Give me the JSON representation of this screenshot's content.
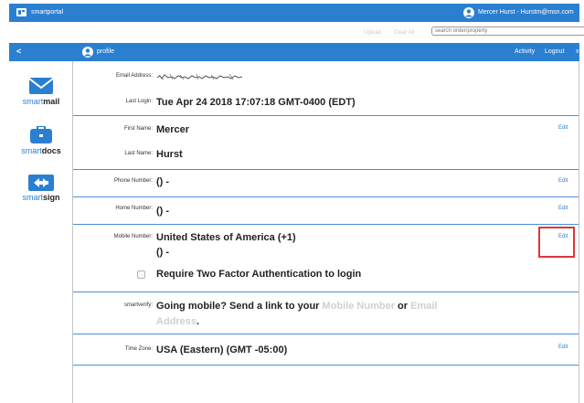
{
  "topbar": {
    "brand": "smartportal",
    "user": "Mercer Hurst - Hurstm@msn.com"
  },
  "subbar": {
    "upload": "Upload",
    "clear_all": "Clear All",
    "search_placeholder": "search order/property"
  },
  "navbar": {
    "back": "<",
    "profile": "profile",
    "activity": "Activity",
    "logout": "Logout",
    "close": "x"
  },
  "sidebar": {
    "items": [
      {
        "prefix": "smart",
        "bold": "mail",
        "icon": "envelope-icon"
      },
      {
        "prefix": "smart",
        "bold": "docs",
        "icon": "briefcase-icon"
      },
      {
        "prefix": "smart",
        "bold": "sign",
        "icon": "sign-arrows-icon"
      }
    ]
  },
  "profile": {
    "email_label": "Email Address:",
    "last_login_label": "Last Login:",
    "last_login": "Tue Apr 24 2018 17:07:18 GMT-0400 (EDT)",
    "first_name_label": "First Name:",
    "first_name": "Mercer",
    "last_name_label": "Last Name:",
    "last_name": "Hurst",
    "phone_label": "Phone Number:",
    "phone": "() -",
    "home_label": "Home Number:",
    "home": "() -",
    "mobile_label": "Mobile Number:",
    "mobile_country": "United States of America (+1)",
    "mobile": "() -",
    "two_factor": "Require Two Factor Authentication to login",
    "smartverify_label": "smartverify:",
    "smartverify_text": "Going mobile? Send a link to your",
    "mobile_number_link": "Mobile Number",
    "or": "or",
    "email_link": "Email",
    "address_link": "Address",
    "period": ".",
    "timezone_label": "Time Zone:",
    "timezone": "USA (Eastern) (GMT -05:00)",
    "edit": "Edit"
  },
  "colors": {
    "brand_blue": "#2b7fd0",
    "highlight_red": "#e0353b"
  }
}
